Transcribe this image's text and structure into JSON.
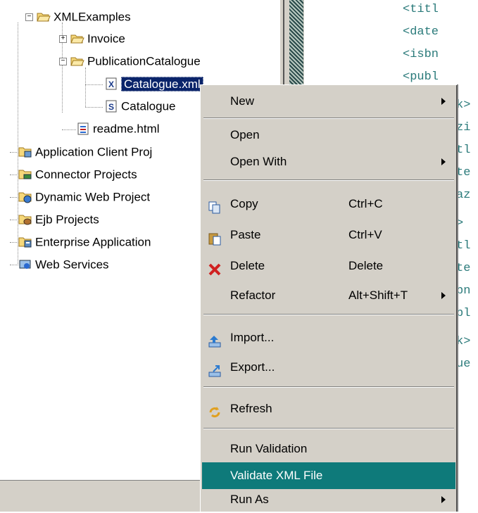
{
  "tree": {
    "items": [
      {
        "label": "XMLExamples",
        "icon": "folder-open-icon"
      },
      {
        "label": "Invoice",
        "icon": "folder-icon"
      },
      {
        "label": "PublicationCatalogue",
        "icon": "folder-open-icon"
      },
      {
        "label": "Catalogue.xml",
        "icon": "xml-file-icon"
      },
      {
        "label": "Catalogue",
        "icon": "schema-file-icon"
      },
      {
        "label": "readme.html",
        "icon": "html-file-icon"
      },
      {
        "label": "Application Client Proj",
        "icon": "app-client-projects-icon"
      },
      {
        "label": "Connector Projects",
        "icon": "connector-projects-icon"
      },
      {
        "label": "Dynamic Web Project",
        "icon": "dynamic-web-projects-icon"
      },
      {
        "label": "Ejb Projects",
        "icon": "ejb-projects-icon"
      },
      {
        "label": "Enterprise Application",
        "icon": "enterprise-app-projects-icon"
      },
      {
        "label": "Web Services",
        "icon": "web-services-icon"
      }
    ]
  },
  "editor": {
    "lines": [
      "<titl",
      "<date",
      "<isbn",
      "<publ"
    ],
    "stubs": [
      "k>",
      "zi",
      "tl",
      "te",
      "az",
      ">",
      "tl",
      "te",
      "bn",
      "bl",
      "k>",
      "ue"
    ]
  },
  "context_menu": {
    "items": {
      "new": {
        "label": "New",
        "submenu": true
      },
      "open": {
        "label": "Open"
      },
      "open_with": {
        "label": "Open With",
        "submenu": true
      },
      "copy": {
        "label": "Copy",
        "shortcut": "Ctrl+C",
        "icon": "copy-icon"
      },
      "paste": {
        "label": "Paste",
        "shortcut": "Ctrl+V",
        "icon": "paste-icon"
      },
      "delete": {
        "label": "Delete",
        "shortcut": "Delete",
        "icon": "delete-icon"
      },
      "refactor": {
        "label": "Refactor",
        "shortcut": "Alt+Shift+T",
        "submenu": true
      },
      "import": {
        "label": "Import...",
        "icon": "import-icon"
      },
      "export": {
        "label": "Export...",
        "icon": "export-icon"
      },
      "refresh": {
        "label": "Refresh",
        "icon": "refresh-icon"
      },
      "run_validation": {
        "label": "Run Validation"
      },
      "validate_xml": {
        "label": "Validate XML File",
        "highlighted": true
      },
      "run_as": {
        "label": "Run As",
        "submenu": true
      }
    }
  },
  "colors": {
    "highlight": "#0e7a7a",
    "selection": "#0a246a",
    "menu_bg": "#d4d0c8",
    "editor_text": "#2a7a7a"
  }
}
